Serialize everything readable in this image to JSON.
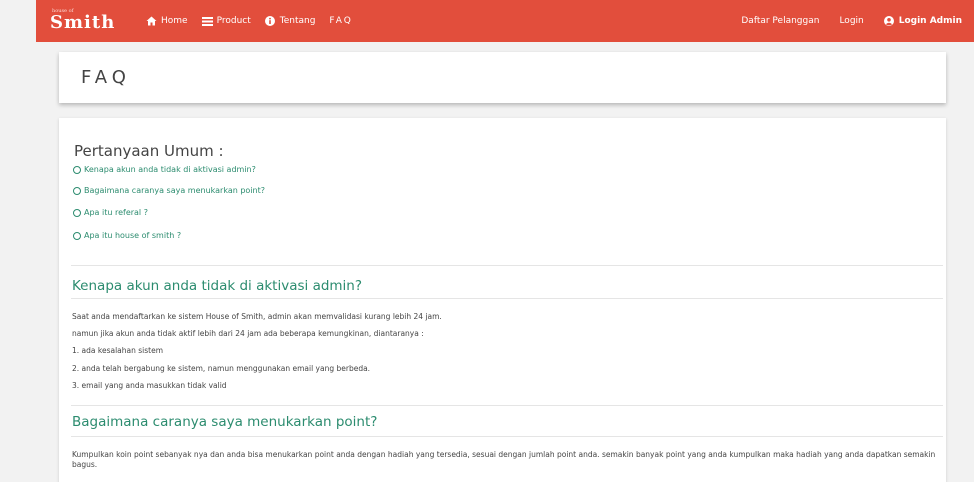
{
  "brand": {
    "small": "house of",
    "main": "Smith"
  },
  "nav": {
    "home": "Home",
    "product": "Product",
    "tentang": "Tentang",
    "faq": "FAQ",
    "daftar": "Daftar Pelanggan",
    "login": "Login",
    "login_admin": "Login Admin"
  },
  "page_title": "FAQ",
  "general": {
    "title": "Pertanyaan Umum :",
    "links": [
      "Kenapa akun anda tidak di aktivasi admin?",
      "Bagaimana caranya saya menukarkan point?",
      "Apa itu referal ?",
      "Apa itu house of smith ?"
    ]
  },
  "answers": [
    {
      "title": "Kenapa akun anda tidak di aktivasi admin?",
      "lines": [
        "Saat anda mendaftarkan ke sistem House of Smith, admin akan memvalidasi kurang lebih 24 jam.",
        "namun jika akun anda  tidak aktif lebih dari 24 jam ada beberapa kemungkinan, diantaranya :",
        "1. ada kesalahan sistem",
        "2. anda telah bergabung ke sistem, namun menggunakan email yang berbeda.",
        "3. email yang anda masukkan tidak valid"
      ]
    },
    {
      "title": "Bagaimana caranya saya menukarkan point?",
      "lines": [
        "Kumpulkan koin point sebanyak nya dan anda bisa menukarkan point anda dengan hadiah yang tersedia, sesuai dengan jumlah point anda. semakin banyak point yang anda kumpulkan maka hadiah yang anda dapatkan semakin bagus."
      ]
    }
  ],
  "colors": {
    "navbar": "#e24e3c",
    "accent": "#2c8c6f"
  }
}
